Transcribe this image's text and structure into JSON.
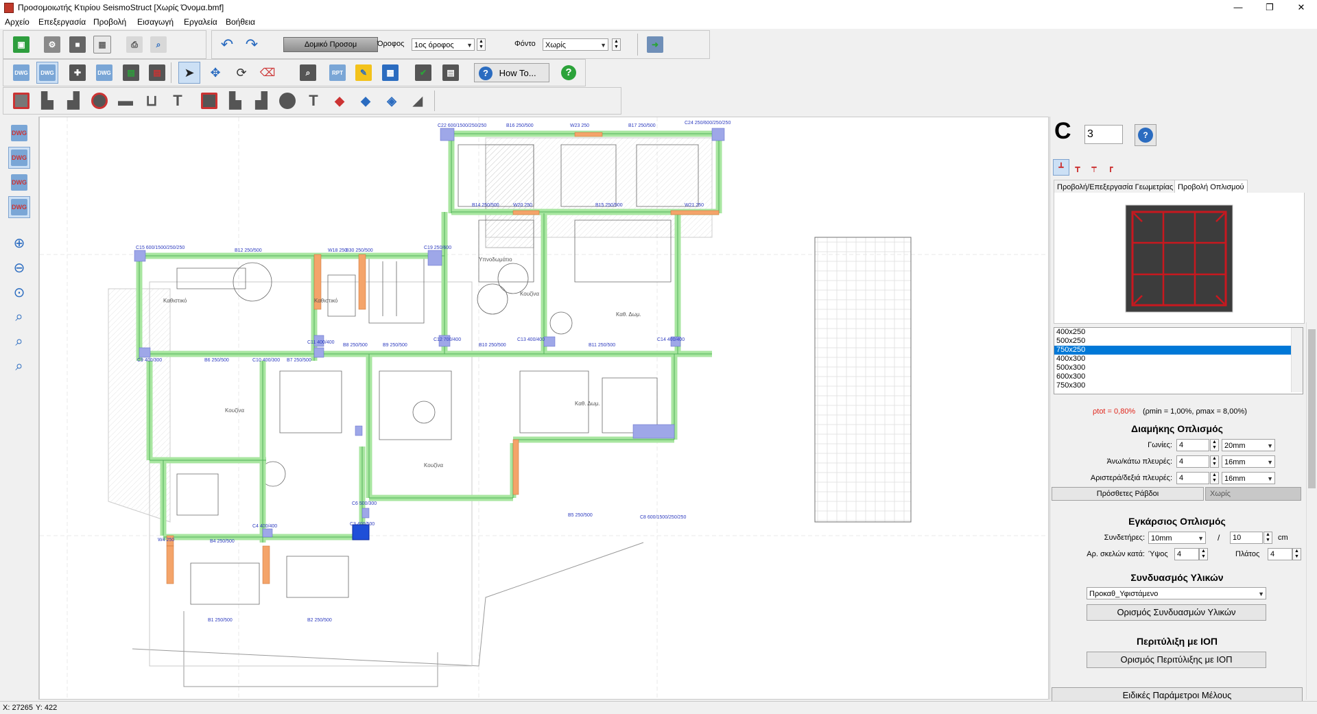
{
  "window": {
    "title": "Προσομοιωτής Κτιρίου SeismoStruct  [Χωρίς Όνομα.bmf]",
    "minimize": "—",
    "restore": "❐",
    "close": "✕"
  },
  "menu": [
    "Αρχείο",
    "Επεξεργασία",
    "Προβολή",
    "Εισαγωγή",
    "Εργαλεία",
    "Βοήθεια"
  ],
  "toolbar": {
    "mode_button": "Δομικό Προσομ",
    "floor_label": "Όροφος",
    "floor_value": "1ος όροφος",
    "background_label": "Φόντο",
    "background_value": "Χωρίς",
    "howto_label": "How To..."
  },
  "status": {
    "x_label": "X: 27265",
    "y_label": "Y: 422"
  },
  "panel": {
    "element_type": "C",
    "element_number": "3",
    "tabs": [
      "Προβολή/Επεξεργασία Γεωμετρίας",
      "Προβολή Οπλισμού"
    ],
    "active_tab": 1,
    "sections": {
      "items": [
        "400x250",
        "500x250",
        "750x250",
        "400x300",
        "500x300",
        "600x300",
        "750x300"
      ],
      "selected_index": 2
    },
    "rho": {
      "ptot": "ρtot = 0,80%",
      "bounds": "(ρmin = 1,00%, ρmax = 8,00%)"
    },
    "longitudinal": {
      "title": "Διαμήκης Οπλισμός",
      "corners_label": "Γωνίες:",
      "corners_count": "4",
      "corners_dia": "20mm",
      "topbottom_label": "Άνω/κάτω πλευρές:",
      "topbottom_count": "4",
      "topbottom_dia": "16mm",
      "leftright_label": "Αριστερά/δεξιά πλευρές:",
      "leftright_count": "4",
      "leftright_dia": "16mm",
      "extra_bars_button": "Πρόσθετες Ράβδοι",
      "extra_bars_value": "Χωρίς"
    },
    "transverse": {
      "title": "Εγκάρσιος Οπλισμός",
      "stirrups_label": "Συνδετήρες:",
      "stirrups_dia": "10mm",
      "slash": "/",
      "spacing": "10",
      "unit": "cm",
      "legs_label": "Αρ. σκελών κατά:",
      "height_label": "Ύψος",
      "height_value": "4",
      "width_label": "Πλάτος",
      "width_value": "4"
    },
    "materials": {
      "title": "Συνδυασμός Υλικών",
      "value": "Προκαθ_Υφιστάμενο",
      "define_button": "Ορισμός Συνδυασμών Υλικών"
    },
    "frp": {
      "title": "Περιτύλιξη με ΙΟΠ",
      "define_button": "Ορισμός Περιτύλιξης με ΙΟΠ"
    },
    "special_button": "Ειδικές Παράμετροι Μέλους"
  },
  "plan": {
    "labels": [
      {
        "t": "C22 600/1500/250/250"
      },
      {
        "t": "B16 250/500"
      },
      {
        "t": "W23 250"
      },
      {
        "t": "B17 250/500"
      },
      {
        "t": "C24 250/600/250/250"
      },
      {
        "t": "C15 600/1500/250/250"
      },
      {
        "t": "B12 250/500"
      },
      {
        "t": "W18 250"
      },
      {
        "t": "B30 250/500"
      },
      {
        "t": "C19 250/600"
      },
      {
        "t": "B14 250/500"
      },
      {
        "t": "W20 250"
      },
      {
        "t": "B15 250/500"
      },
      {
        "t": "W21 250"
      },
      {
        "t": "C11 400/400"
      },
      {
        "t": "B8 250/500"
      },
      {
        "t": "B9 250/500"
      },
      {
        "t": "C12 700/400"
      },
      {
        "t": "B10 250/500"
      },
      {
        "t": "C13 400/400"
      },
      {
        "t": "B11 250/500"
      },
      {
        "t": "C14 400/400"
      },
      {
        "t": "C9 400/300"
      },
      {
        "t": "B6 250/500"
      },
      {
        "t": "C10 400/300"
      },
      {
        "t": "B7 250/500"
      },
      {
        "t": "C6 500/300"
      },
      {
        "t": "B5 250/500"
      },
      {
        "t": "C8 600/1500/250/250"
      },
      {
        "t": "C4 400/400"
      },
      {
        "t": "B4 250/500"
      },
      {
        "t": "W4 250"
      },
      {
        "t": "B1 250/500"
      },
      {
        "t": "B2 250/500"
      },
      {
        "t": "C3 400/500"
      }
    ],
    "rooms": [
      {
        "t": "Καθιστικό"
      },
      {
        "t": "Κουζίνα"
      },
      {
        "t": "Υπνοδωμάτιο"
      },
      {
        "t": "Καθ. Δωμ."
      },
      {
        "t": "Κουζίνα"
      },
      {
        "t": "Καθιστικό"
      },
      {
        "t": "Καθ. Δωμ."
      },
      {
        "t": "Κουζίνα"
      }
    ]
  },
  "colors": {
    "beam": "#a8e6a0",
    "beam_border": "#52b35a",
    "column": "#9ea7e8",
    "wall": "#f4a46a",
    "selected_column": "#1f4fd8",
    "plan_line": "#6b6b6b"
  }
}
